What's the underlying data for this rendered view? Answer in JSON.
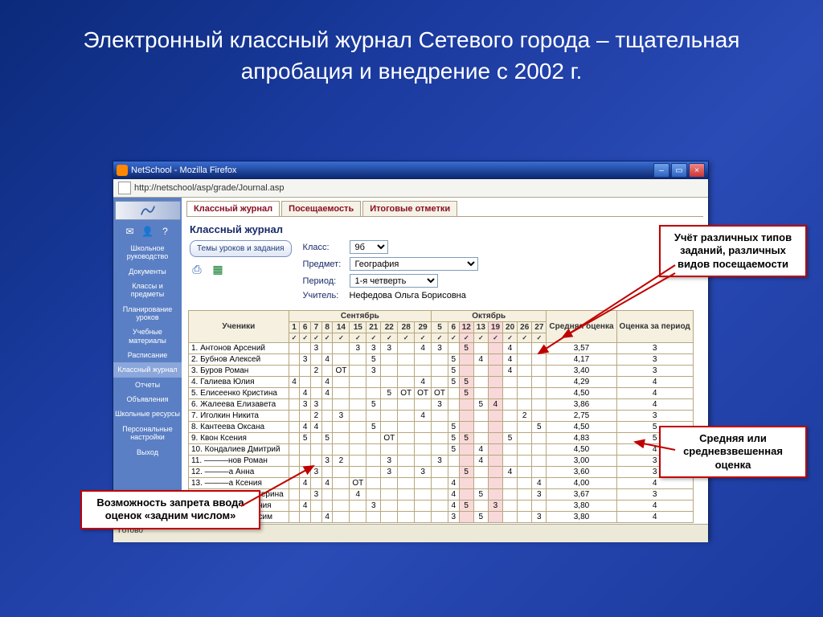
{
  "slide": {
    "title": "Электронный классный журнал Сетевого города – тщательная апробация и внедрение с 2002 г."
  },
  "window": {
    "title": "NetSchool - Mozilla Firefox",
    "url": "http://netschool/asp/grade/Journal.asp",
    "status": "Готово"
  },
  "sidebar": {
    "items": [
      "Школьное руководство",
      "Документы",
      "Классы и предметы",
      "Планирование уроков",
      "Учебные материалы",
      "Расписание",
      "Классный журнал",
      "Отчеты",
      "Объявления",
      "Школьные ресурсы",
      "Персональные настройки",
      "Выход"
    ],
    "selected_index": 6
  },
  "tabs": {
    "items": [
      "Классный журнал",
      "Посещаемость",
      "Итоговые отметки"
    ],
    "selected": 0
  },
  "journal": {
    "heading": "Классный журнал",
    "topics_btn": "Темы уроков и задания",
    "labels": {
      "class": "Класс:",
      "subject": "Предмет:",
      "period": "Период:",
      "teacher": "Учитель:"
    },
    "class_value": "9б",
    "subject_value": "География",
    "period_value": "1-я четверть",
    "teacher_value": "Нефедова Ольга Борисовна"
  },
  "table": {
    "students_header": "Ученики",
    "months": [
      "Сентябрь",
      "Октябрь"
    ],
    "sept_days": [
      1,
      6,
      7,
      8,
      14,
      15,
      21,
      22,
      28,
      29
    ],
    "oct_days": [
      5,
      6,
      12,
      13,
      19,
      20,
      26,
      27
    ],
    "avg_header": "Средняя оценка",
    "period_header": "Оценка за период",
    "students": [
      {
        "n": 1,
        "name": "Антонов Арсений",
        "sept": [
          "",
          "",
          "3",
          "",
          "",
          "3",
          "3",
          "3",
          "",
          "4"
        ],
        "oct": [
          "3",
          "",
          "5",
          "",
          "",
          "4",
          "",
          ""
        ],
        "avg": "3,57",
        "per": "3"
      },
      {
        "n": 2,
        "name": "Бубнов Алексей",
        "sept": [
          "",
          "3",
          "",
          "4",
          "",
          "",
          "5",
          "",
          "",
          ""
        ],
        "oct": [
          "",
          "5",
          "",
          "4",
          "",
          "4",
          "",
          ""
        ],
        "avg": "4,17",
        "per": "3"
      },
      {
        "n": 3,
        "name": "Буров Роман",
        "sept": [
          "",
          "",
          "2",
          "",
          "ОТ",
          "",
          "3",
          "",
          "",
          ""
        ],
        "oct": [
          "",
          "5",
          "",
          "",
          "",
          "4",
          "",
          ""
        ],
        "avg": "3,40",
        "per": "3"
      },
      {
        "n": 4,
        "name": "Галиева Юлия",
        "sept": [
          "4",
          "",
          "",
          "4",
          "",
          "",
          "",
          "",
          "",
          "4"
        ],
        "oct": [
          "",
          "5",
          "5",
          "",
          "",
          "",
          "",
          ""
        ],
        "avg": "4,29",
        "per": "4"
      },
      {
        "n": 5,
        "name": "Елисеенко Кристина",
        "sept": [
          "",
          "4",
          "",
          "4",
          "",
          "",
          "",
          "5",
          "ОТ",
          "ОТ"
        ],
        "oct": [
          "ОТ",
          "",
          "5",
          "",
          "",
          "",
          "",
          ""
        ],
        "avg": "4,50",
        "per": "4"
      },
      {
        "n": 6,
        "name": "Жалеева Елизавета",
        "sept": [
          "",
          "3",
          "3",
          "",
          "",
          "",
          "5",
          "",
          "",
          ""
        ],
        "oct": [
          "3",
          "",
          "",
          "5",
          "4",
          "",
          "",
          ""
        ],
        "avg": "3,86",
        "per": "4"
      },
      {
        "n": 7,
        "name": "Иголкин Никита",
        "sept": [
          "",
          "",
          "2",
          "",
          "3",
          "",
          "",
          "",
          "",
          "4"
        ],
        "oct": [
          "",
          "",
          "",
          "",
          "",
          "",
          "2",
          ""
        ],
        "avg": "2,75",
        "per": "3"
      },
      {
        "n": 8,
        "name": "Кантеева Оксана",
        "sept": [
          "",
          "4",
          "4",
          "",
          "",
          "",
          "5",
          "",
          "",
          ""
        ],
        "oct": [
          "",
          "5",
          "",
          "",
          "",
          "",
          "",
          "5"
        ],
        "avg": "4,50",
        "per": "5"
      },
      {
        "n": 9,
        "name": "Квон Ксения",
        "sept": [
          "",
          "5",
          "",
          "5",
          "",
          "",
          "",
          "ОТ",
          "",
          ""
        ],
        "oct": [
          "",
          "5",
          "5",
          "",
          "",
          "5",
          "",
          ""
        ],
        "avg": "4,83",
        "per": "5"
      },
      {
        "n": 10,
        "name": "Кондалиев Дмитрий",
        "sept": [
          "",
          "",
          "",
          "",
          "",
          "",
          "",
          "",
          "",
          ""
        ],
        "oct": [
          "",
          "5",
          "",
          "4",
          "",
          "",
          "",
          ""
        ],
        "avg": "4,50",
        "per": "4"
      },
      {
        "n": 11,
        "name": "———нов Роман",
        "sept": [
          "",
          "",
          "",
          "3",
          "2",
          "",
          "",
          "3",
          "",
          ""
        ],
        "oct": [
          "3",
          "",
          "",
          "4",
          "",
          "",
          "",
          ""
        ],
        "avg": "3,00",
        "per": "3"
      },
      {
        "n": 12,
        "name": "———а Анна",
        "sept": [
          "",
          "",
          "3",
          "",
          "",
          "",
          "",
          "3",
          "",
          "3"
        ],
        "oct": [
          "",
          "",
          "5",
          "",
          "",
          "4",
          "",
          ""
        ],
        "avg": "3,60",
        "per": "3"
      },
      {
        "n": 13,
        "name": "———а Ксения",
        "sept": [
          "",
          "4",
          "",
          "4",
          "",
          "ОТ",
          "",
          "",
          "",
          ""
        ],
        "oct": [
          "",
          "4",
          "",
          "",
          "",
          "",
          "",
          "4"
        ],
        "avg": "4,00",
        "per": "4"
      },
      {
        "n": 14,
        "name": "———ова Екатерина",
        "sept": [
          "",
          "",
          "3",
          "",
          "",
          "4",
          "",
          "",
          "",
          ""
        ],
        "oct": [
          "",
          "4",
          "",
          "5",
          "",
          "",
          "",
          "3"
        ],
        "avg": "3,67",
        "per": "3"
      },
      {
        "n": 15,
        "name": "Молодева Ксения",
        "sept": [
          "",
          "4",
          "",
          "",
          "",
          "",
          "3",
          "",
          "",
          ""
        ],
        "oct": [
          "",
          "4",
          "5",
          "",
          "3",
          "",
          "",
          ""
        ],
        "avg": "3,80",
        "per": "4"
      },
      {
        "n": 16,
        "name": "Нестарых Максим",
        "sept": [
          "",
          "",
          "",
          "4",
          "",
          "",
          "",
          "",
          "",
          ""
        ],
        "oct": [
          "",
          "3",
          "",
          "5",
          "",
          "",
          "",
          "3"
        ],
        "avg": "3,80",
        "per": "4"
      }
    ],
    "highlight_oct_cols": [
      2,
      4
    ]
  },
  "callouts": {
    "c1": "Учёт различных типов заданий, различных видов посещаемости",
    "c2": "Средняя или средневзвешенная оценка",
    "c3": "Возможность запрета ввода оценок «задним числом»"
  }
}
